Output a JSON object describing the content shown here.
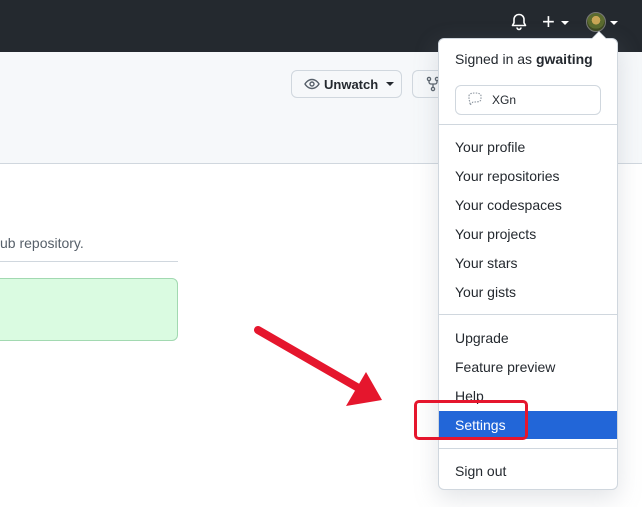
{
  "header": {
    "icons": [
      "bell-icon",
      "plus-icon",
      "avatar"
    ]
  },
  "repo": {
    "unwatch_label": "Unwatch",
    "description_fragment": "ub repository."
  },
  "menu": {
    "signed_in_prefix": "Signed in as ",
    "username": "gwaiting",
    "status_text": "XGn",
    "group1": [
      "Your profile",
      "Your repositories",
      "Your codespaces",
      "Your projects",
      "Your stars",
      "Your gists"
    ],
    "group2": [
      "Upgrade",
      "Feature preview",
      "Help",
      "Settings"
    ],
    "active_item": "Settings",
    "sign_out": "Sign out"
  },
  "annotation": {
    "arrow_color": "#e5162d",
    "highlight_color": "#e5162d"
  },
  "colors": {
    "header_bg": "#24292f",
    "active_bg": "#2266d8",
    "flash_bg": "#dafbe1"
  }
}
